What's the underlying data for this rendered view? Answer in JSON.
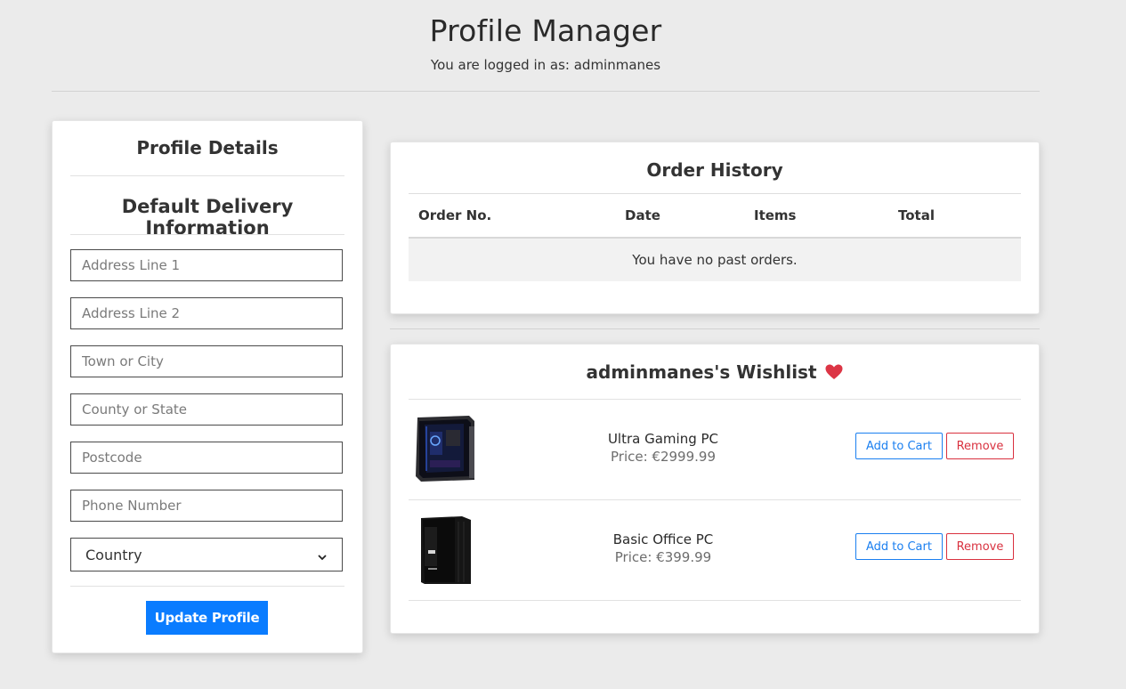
{
  "header": {
    "title": "Profile Manager",
    "logged_in_text": "You are logged in as: adminmanes"
  },
  "profile": {
    "heading": "Profile Details",
    "delivery_heading": "Default Delivery Information",
    "fields": {
      "address1_placeholder": "Address Line 1",
      "address2_placeholder": "Address Line 2",
      "town_placeholder": "Town or City",
      "county_placeholder": "County or State",
      "postcode_placeholder": "Postcode",
      "phone_placeholder": "Phone Number"
    },
    "country_select": {
      "selected": "Country",
      "icon": "chevron-down-icon"
    },
    "update_button": "Update Profile",
    "update_button_color": "#0a7cff"
  },
  "orders": {
    "heading": "Order History",
    "columns": [
      "Order No.",
      "Date",
      "Items",
      "Total"
    ],
    "empty_message": "You have no past orders."
  },
  "wishlist": {
    "heading": "adminmanes's Wishlist",
    "heart_icon": "heart-icon",
    "heart_color": "#dc3545",
    "items": [
      {
        "name": "Ultra Gaming PC",
        "price": "Price: €2999.99",
        "add_label": "Add to Cart",
        "remove_label": "Remove"
      },
      {
        "name": "Basic Office PC",
        "price": "Price: €399.99",
        "add_label": "Add to Cart",
        "remove_label": "Remove"
      }
    ]
  }
}
